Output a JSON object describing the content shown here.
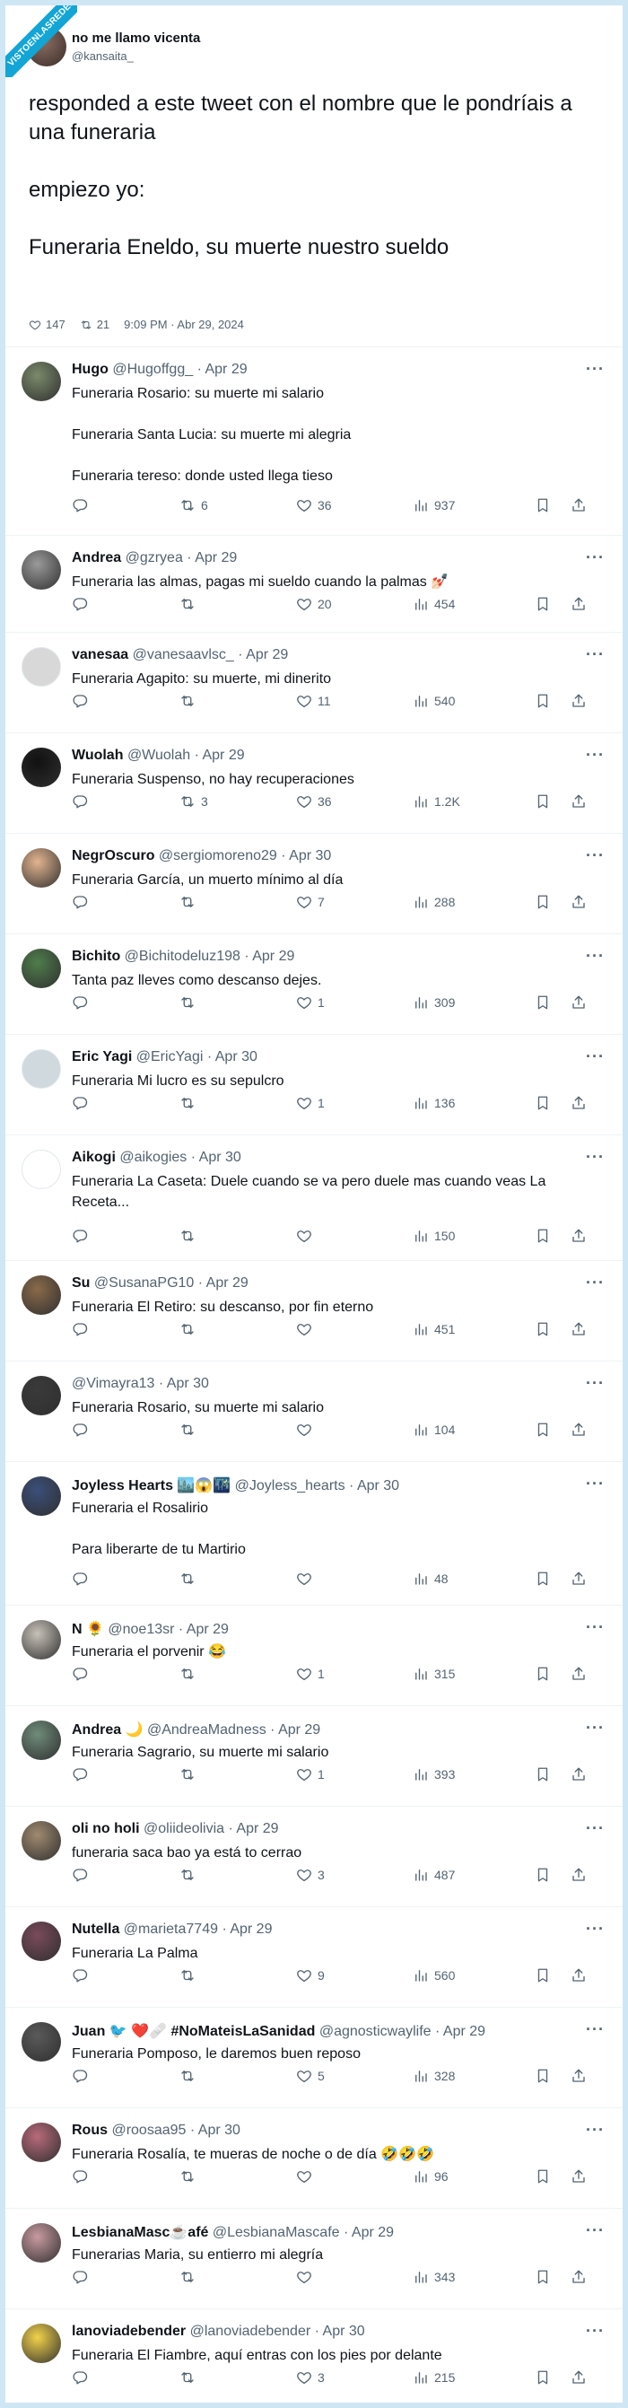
{
  "colors": {
    "background": "#cfe6f5",
    "card": "#ffffff",
    "badge": "#12a5d6",
    "text": "#0f1419",
    "muted": "#536471"
  },
  "badge_text": "VISTOENLASREDES",
  "main_tweet": {
    "name": "no me llamo vicenta",
    "handle": "@kansaita_",
    "text": "responded a este tweet con el nombre que le pondríais a una funeraria\n\nempiezo yo:\n\nFuneraria Eneldo, su muerte nuestro sueldo",
    "likes": "147",
    "retweets": "21",
    "timestamp": "9:09 PM · Abr 29, 2024"
  },
  "replies": [
    {
      "name": "Hugo",
      "handle": "@Hugoffgg_",
      "date": "· Apr 29",
      "text": "Funeraria Rosario: su muerte mi salario\n\nFuneraria Santa Lucia: su muerte mi alegria\n\nFuneraria tereso: donde usted llega tieso",
      "retweets": "6",
      "likes": "36",
      "views": "937",
      "avatar_color": "#7a8a6a"
    },
    {
      "name": "Andrea",
      "handle": "@gzryea",
      "date": "· Apr 29",
      "text": "Funeraria las almas, pagas mi sueldo cuando la palmas 💅🏻",
      "retweets": "",
      "likes": "20",
      "views": "454",
      "avatar_color": "#9a9a9a"
    },
    {
      "name": "vanesaa",
      "handle": "@vanesaavlsc_",
      "date": "· Apr 29",
      "text": "Funeraria Agapito: su muerte, mi dinerito",
      "retweets": "",
      "likes": "11",
      "views": "540",
      "avatar_color": "#d8d8d8"
    },
    {
      "name": "Wuolah",
      "handle": "@Wuolah",
      "date": "· Apr 29",
      "text": "Funeraria Suspenso, no hay recuperaciones",
      "retweets": "3",
      "likes": "36",
      "views": "1.2K",
      "avatar_color": "#111111"
    },
    {
      "name": "NegrOscuro",
      "handle": "@sergiomoreno29",
      "date": "· Apr 30",
      "text": "Funeraria García, un muerto mínimo al día",
      "retweets": "",
      "likes": "7",
      "views": "288",
      "avatar_color": "#e3b48f"
    },
    {
      "name": "Bichito",
      "handle": "@Bichitodeluz198",
      "date": "· Apr 29",
      "text": "Tanta paz lleves como descanso dejes.",
      "retweets": "",
      "likes": "1",
      "views": "309",
      "avatar_color": "#4f7d4c"
    },
    {
      "name": "Eric Yagi",
      "handle": "@EricYagi",
      "date": "· Apr 30",
      "text": "Funeraria Mi lucro es su sepulcro",
      "retweets": "",
      "likes": "1",
      "views": "136",
      "avatar_color": "#cfd9de"
    },
    {
      "name": "Aikogi",
      "handle": "@aikogies",
      "date": "· Apr 30",
      "text": "Funeraria La Caseta: Duele cuando se va pero duele mas cuando veas La Receta...",
      "retweets": "",
      "likes": "",
      "views": "150",
      "avatar_color": "#ffffff"
    },
    {
      "name": "Su",
      "handle": "@SusanaPG10",
      "date": "· Apr 29",
      "text": "Funeraria El Retiro: su descanso, por fin eterno",
      "retweets": "",
      "likes": "",
      "views": "451",
      "avatar_color": "#8a6a4a"
    },
    {
      "name": "",
      "handle": "@Vimayra13",
      "date": "· Apr 30",
      "text": "Funeraria Rosario, su muerte mi salario",
      "retweets": "",
      "likes": "",
      "views": "104",
      "avatar_color": "#3a3a3a"
    },
    {
      "name": "Joyless Hearts 🏙️😱🌃",
      "handle": "@Joyless_hearts",
      "date": "· Apr 30",
      "text": "Funeraria el Rosalirio\n\nPara liberarte de tu Martirio",
      "retweets": "",
      "likes": "",
      "views": "48",
      "avatar_color": "#3b4f7a"
    },
    {
      "name": "N 🌻",
      "handle": "@noe13sr",
      "date": "· Apr 29",
      "text": "Funeraria el porvenir 😂",
      "retweets": "",
      "likes": "1",
      "views": "315",
      "avatar_color": "#c7c1b8"
    },
    {
      "name": "Andrea 🌙",
      "handle": "@AndreaMadness",
      "date": "· Apr 29",
      "text": "Funeraria Sagrario, su muerte mi salario",
      "retweets": "",
      "likes": "1",
      "views": "393",
      "avatar_color": "#6f8c7a"
    },
    {
      "name": "oli no holi",
      "handle": "@oliideolivia",
      "date": "· Apr 29",
      "text": "funeraria saca bao ya está to cerrao",
      "retweets": "",
      "likes": "3",
      "views": "487",
      "avatar_color": "#a08a70"
    },
    {
      "name": "Nutella",
      "handle": "@marieta7749",
      "date": "· Apr 29",
      "text": "Funeraria La Palma",
      "retweets": "",
      "likes": "9",
      "views": "560",
      "avatar_color": "#7a4a5a"
    },
    {
      "name": "Juan 🐦 ❤️🩹 #NoMateisLaSanidad",
      "handle": "@agnosticwaylife",
      "date": "· Apr 29",
      "text": "Funeraria Pomposo, le daremos buen reposo",
      "retweets": "",
      "likes": "5",
      "views": "328",
      "avatar_color": "#5a5a5a"
    },
    {
      "name": "Rous",
      "handle": "@roosaa95",
      "date": "· Apr 30",
      "text": "Funeraria Rosalía, te mueras de noche o de día 🤣🤣🤣",
      "retweets": "",
      "likes": "",
      "views": "96",
      "avatar_color": "#b86a7a"
    },
    {
      "name": "LesbianaMasc☕afé",
      "handle": "@LesbianaMascafe",
      "date": "· Apr 29",
      "text": "Funerarias Maria, su entierro mi alegría",
      "retweets": "",
      "likes": "",
      "views": "343",
      "avatar_color": "#c89aa0"
    },
    {
      "name": "lanoviadebender",
      "handle": "@lanoviadebender",
      "date": "· Apr 30",
      "text": "Funeraria El Fiambre, aquí entras con los pies por delante",
      "retweets": "",
      "likes": "3",
      "views": "215",
      "avatar_color": "#f2d24a"
    }
  ],
  "icons": {
    "reply": "reply-icon",
    "retweet": "retweet-icon",
    "like": "heart-icon",
    "views": "views-icon",
    "bookmark": "bookmark-icon",
    "share": "share-icon",
    "more": "more-icon"
  }
}
